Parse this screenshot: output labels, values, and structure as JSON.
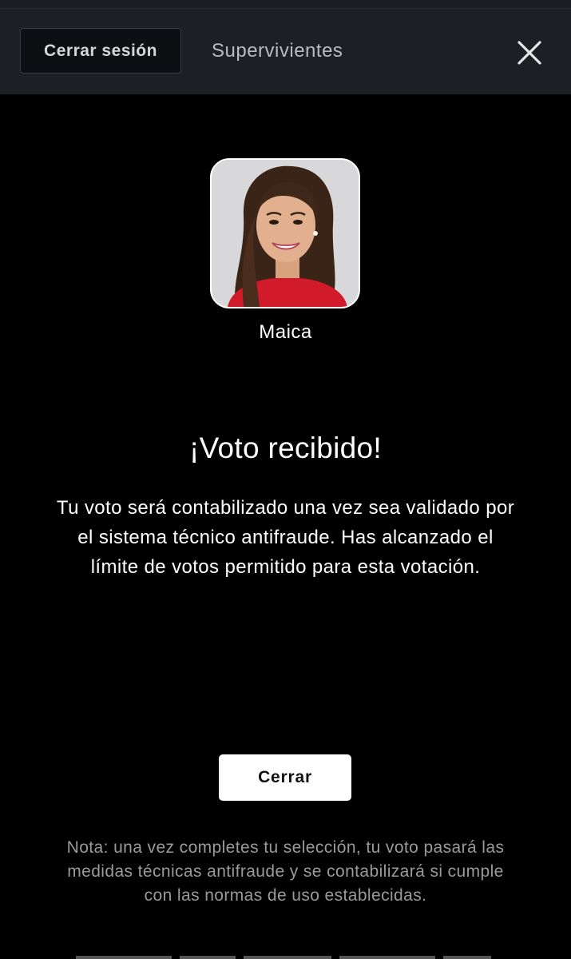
{
  "header": {
    "logout_label": "Cerrar sesión",
    "title": "Supervivientes",
    "close_icon": "close-icon"
  },
  "candidate": {
    "name": "Maica",
    "photo_icon": "candidate-photo"
  },
  "confirmation": {
    "title": "¡Voto recibido!",
    "message": "Tu voto será contabilizado una vez sea validado por el sistema técnico antifraude. Has alcanzado el límite de votos permitido para esta votación.",
    "close_label": "Cerrar"
  },
  "note": "Nota: una vez completes tu selección, tu voto pasará las medidas técnicas antifraude y se contabilizará si cumple con las normas de uso establecidas.",
  "colors": {
    "background": "#000000",
    "header_bg": "#1c1f24",
    "primary_text": "#ffffff",
    "note_text": "#9a9a9a"
  }
}
